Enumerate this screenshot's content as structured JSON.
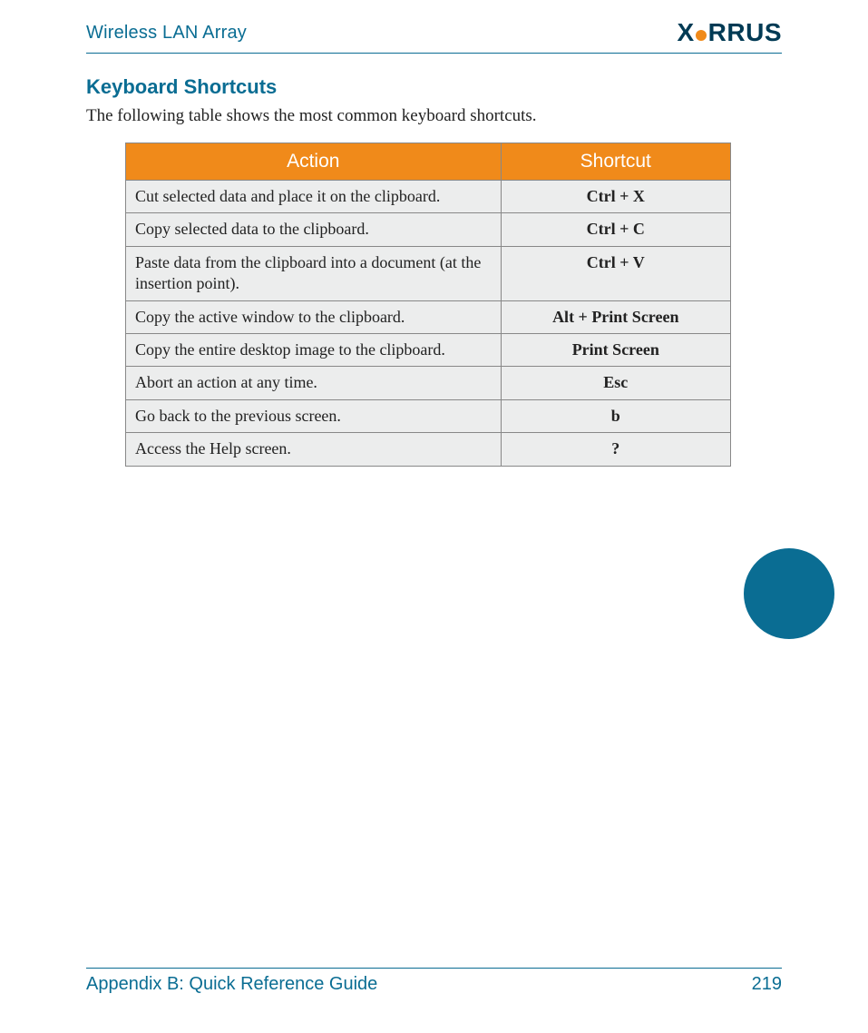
{
  "header": {
    "doc_title": "Wireless LAN Array",
    "logo_pre": "X",
    "logo_post": "RRUS"
  },
  "section": {
    "heading": "Keyboard Shortcuts",
    "intro": "The following table shows the most common keyboard shortcuts."
  },
  "table": {
    "col_action": "Action",
    "col_shortcut": "Shortcut",
    "rows": [
      {
        "action": "Cut selected data and place it on the clipboard.",
        "shortcut": "Ctrl + X"
      },
      {
        "action": "Copy selected data to the clipboard.",
        "shortcut": "Ctrl + C"
      },
      {
        "action": "Paste data from the clipboard into a document (at the insertion point).",
        "shortcut": "Ctrl + V"
      },
      {
        "action": "Copy the active window to the clipboard.",
        "shortcut": "Alt + Print Screen"
      },
      {
        "action": "Copy the entire desktop image to the clipboard.",
        "shortcut": "Print Screen"
      },
      {
        "action": "Abort an action at any time.",
        "shortcut": "Esc"
      },
      {
        "action": "Go back to the previous screen.",
        "shortcut": "b"
      },
      {
        "action": "Access the Help screen.",
        "shortcut": "?"
      }
    ]
  },
  "footer": {
    "appendix": "Appendix B: Quick Reference Guide",
    "page": "219"
  }
}
